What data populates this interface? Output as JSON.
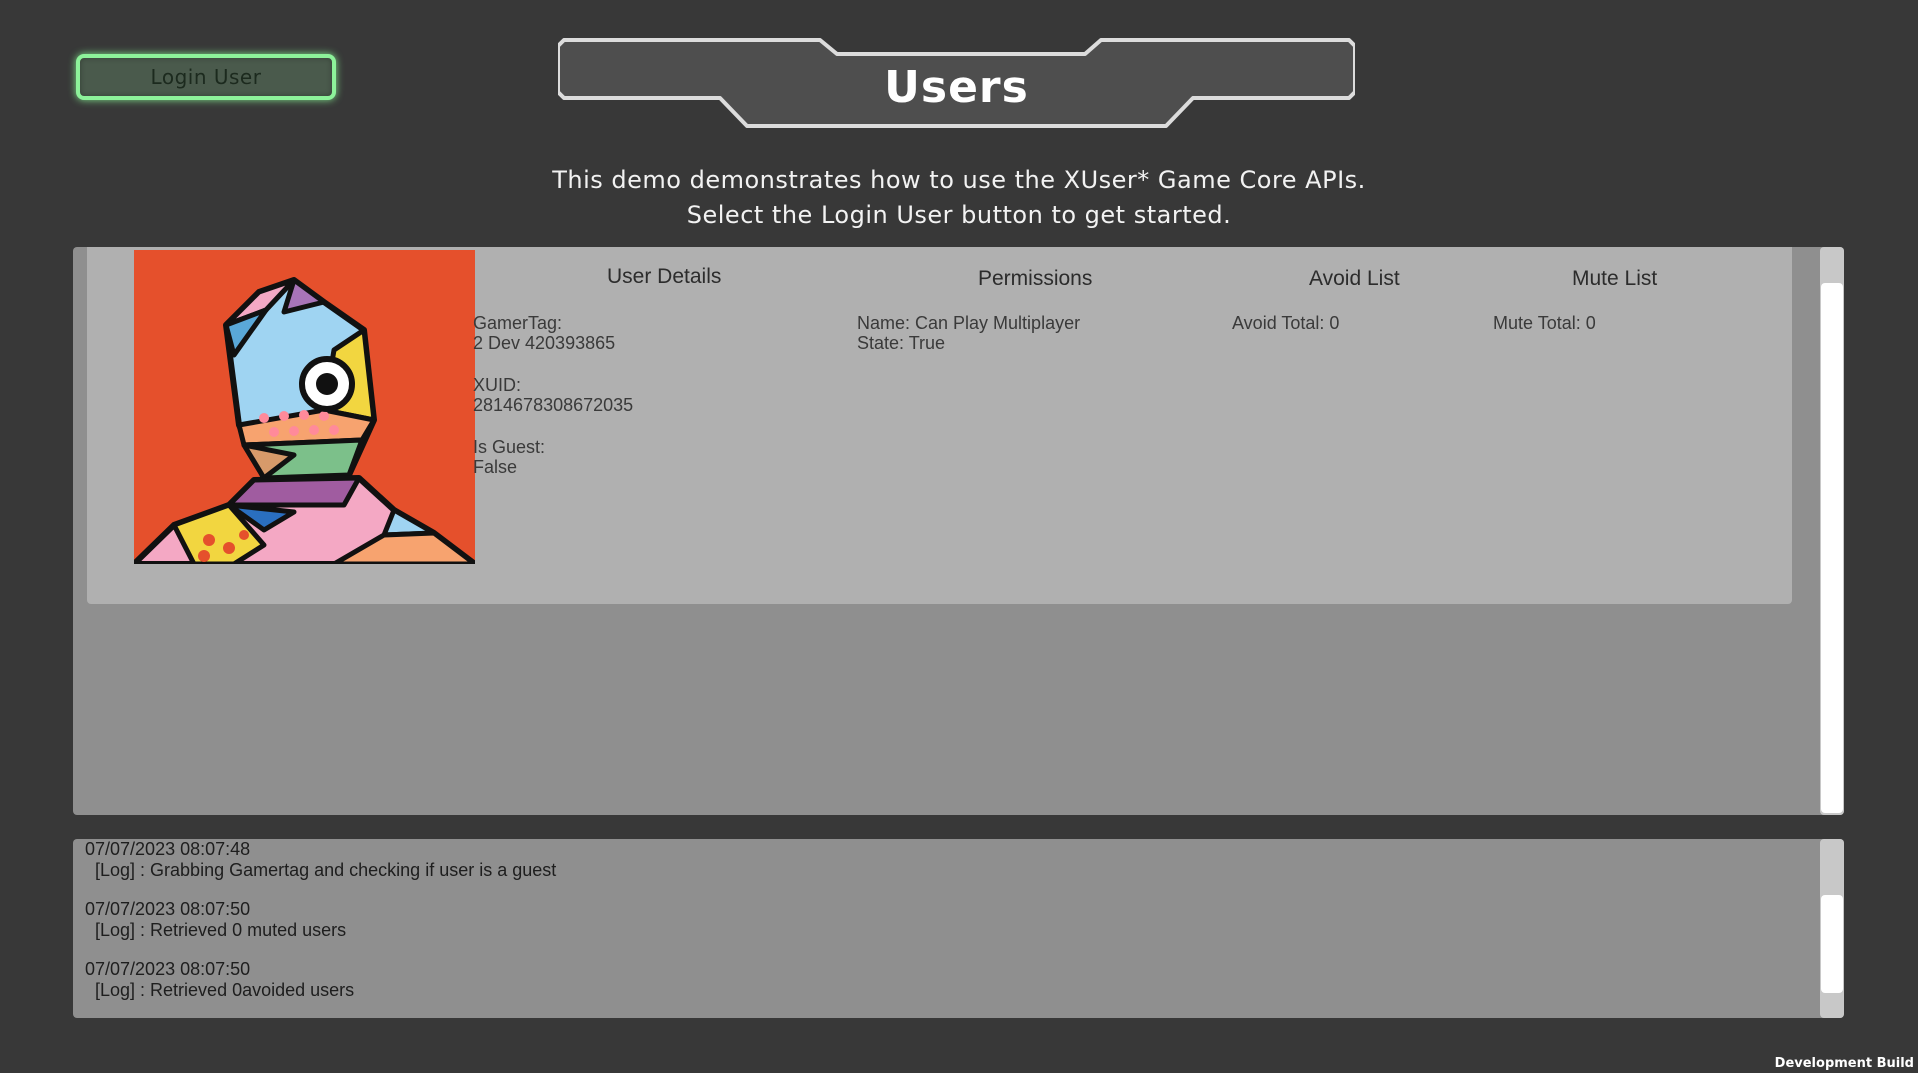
{
  "login_button": {
    "label": "Login User"
  },
  "header": {
    "title": "Users"
  },
  "intro": {
    "line1": "This demo demonstrates how to use the XUser* Game Core APIs.",
    "line2": "Select the Login User button to get started."
  },
  "user_card": {
    "details": {
      "title": "User Details",
      "gamertag_label": "GamerTag:",
      "gamertag_value": "2 Dev 420393865",
      "xuid_label": "XUID:",
      "xuid_value": "2814678308672035",
      "guest_label": "Is Guest:",
      "guest_value": "False"
    },
    "permissions": {
      "title": "Permissions",
      "name": "Name: Can Play Multiplayer",
      "state": "State: True"
    },
    "avoid": {
      "title": "Avoid List",
      "total": "Avoid Total: 0"
    },
    "mute": {
      "title": "Mute List",
      "total": "Mute Total: 0"
    }
  },
  "log": [
    {
      "time": "07/07/2023 08:07:48",
      "message": "[Log] : Grabbing Gamertag and checking if user is a guest"
    },
    {
      "time": "07/07/2023 08:07:50",
      "message": "[Log] : Retrieved 0 muted users"
    },
    {
      "time": "07/07/2023 08:07:50",
      "message": "[Log] : Retrieved 0avoided users"
    }
  ],
  "footer": {
    "build_label": "Development Build"
  },
  "colors": {
    "background": "#383838",
    "login_border": "#8df29a",
    "panel": "#8f8f8f",
    "card": "#b0b0b0"
  }
}
